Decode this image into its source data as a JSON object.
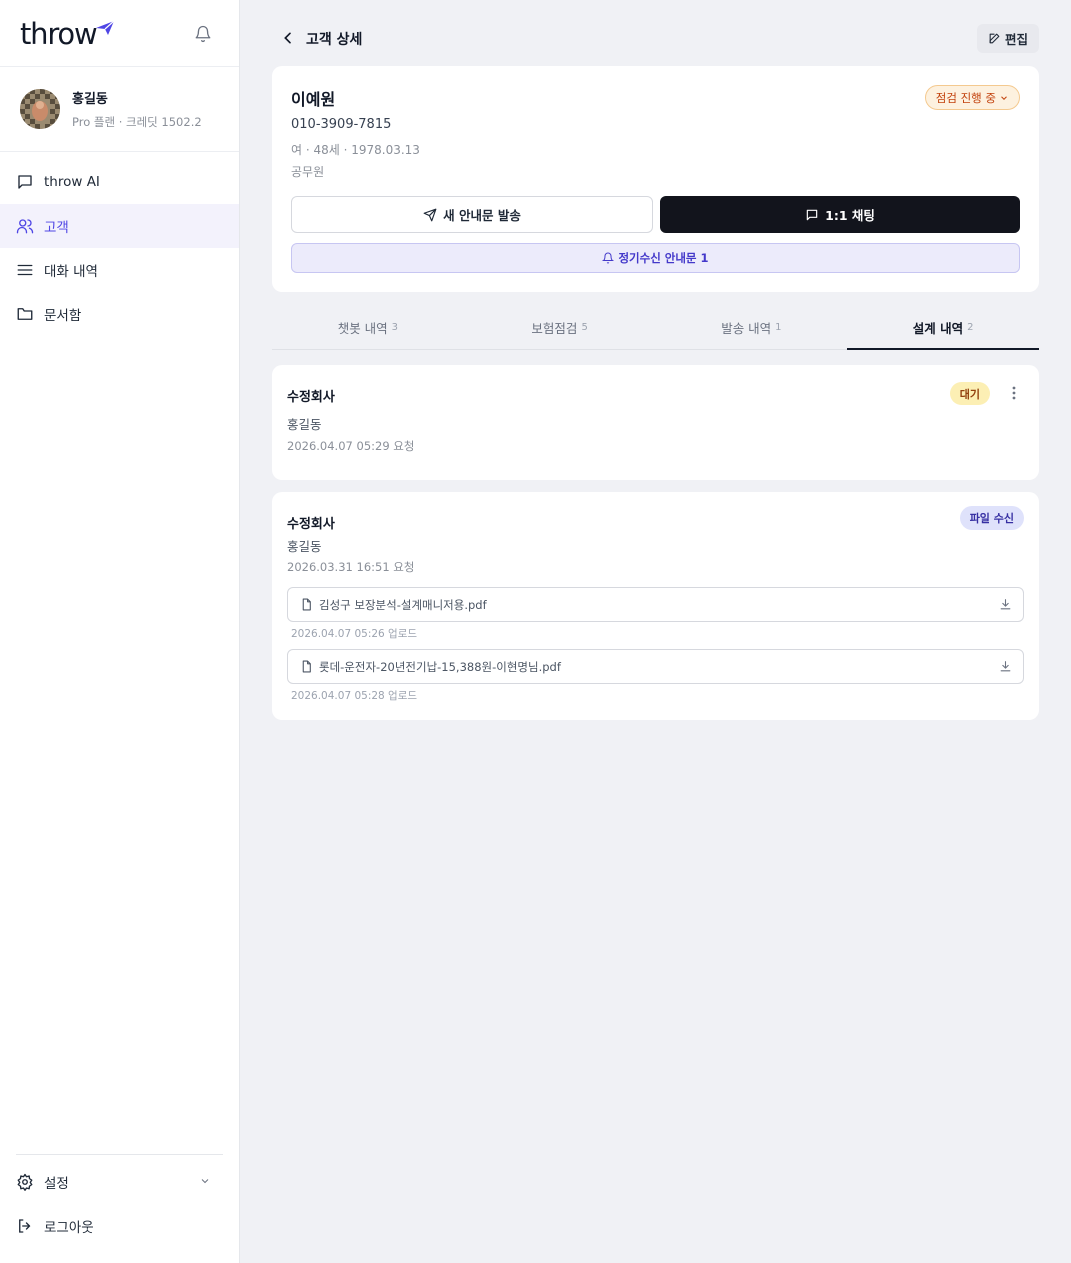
{
  "app": {
    "logo_text": "throw"
  },
  "profile": {
    "name": "홍길동",
    "subtitle": "Pro 플랜 · 크레딧 1502.2"
  },
  "sidebar": {
    "items": [
      {
        "label": "throw AI",
        "icon": "chat-icon"
      },
      {
        "label": "고객",
        "icon": "users-icon",
        "active": true
      },
      {
        "label": "대화 내역",
        "icon": "list-icon"
      },
      {
        "label": "문서함",
        "icon": "folder-icon"
      }
    ],
    "settings_label": "설정",
    "logout_label": "로그아웃"
  },
  "header": {
    "title": "고객 상세",
    "edit_label": "편집"
  },
  "customer": {
    "name": "이예원",
    "status": "점검 진행 중",
    "phone": "010-3909-7815",
    "info": "여 · 48세 · 1978.03.13",
    "job": "공무원",
    "send_label": "새 안내문 발송",
    "chat_label": "1:1 채팅",
    "regular_label": "정기수신 안내문 1"
  },
  "tabs": [
    {
      "label": "챗봇 내역",
      "count": "3"
    },
    {
      "label": "보험점검",
      "count": "5"
    },
    {
      "label": "발송 내역",
      "count": "1"
    },
    {
      "label": "설계 내역",
      "count": "2",
      "active": true
    }
  ],
  "designs": [
    {
      "title": "수정회사",
      "person": "홍길동",
      "date": "2026.04.07 05:29 요청",
      "badge": "대기",
      "badge_color": "#fcefb4"
    },
    {
      "title": "수정회사",
      "person": "홍길동",
      "date": "2026.03.31 16:51 요청",
      "badge": "파일 수신",
      "badge_color": "#dfe2fb",
      "files": [
        {
          "name": "김성구 보장분석-설계매니저용.pdf",
          "uploaded": "2026.04.07 05:26 업로드"
        },
        {
          "name": "롯데-운전자-20년전기납-15,388원-이현명님.pdf",
          "uploaded": "2026.04.07 05:28 업로드"
        }
      ]
    }
  ],
  "colors": {
    "accent": "#4f46e5",
    "dark_button": "#12141c",
    "status_orange": "#c2410c"
  }
}
